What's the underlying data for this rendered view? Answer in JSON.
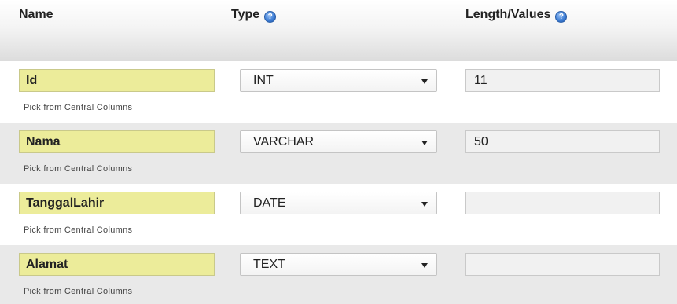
{
  "header": {
    "name_label": "Name",
    "type_label": "Type",
    "length_label": "Length/Values",
    "help_icon": "help-icon"
  },
  "rows": [
    {
      "name": "Id",
      "type": "INT",
      "length": "11",
      "pick_link": "Pick from Central Columns"
    },
    {
      "name": "Nama",
      "type": "VARCHAR",
      "length": "50",
      "pick_link": "Pick from Central Columns"
    },
    {
      "name": "TanggalLahir",
      "type": "DATE",
      "length": "",
      "pick_link": "Pick from Central Columns"
    },
    {
      "name": "Alamat",
      "type": "TEXT",
      "length": "",
      "pick_link": "Pick from Central Columns"
    }
  ],
  "colors": {
    "name_field_bg": "#ecec9a",
    "alt_row_bg": "#e9e9e9",
    "help_icon": "#3f7fd6"
  }
}
